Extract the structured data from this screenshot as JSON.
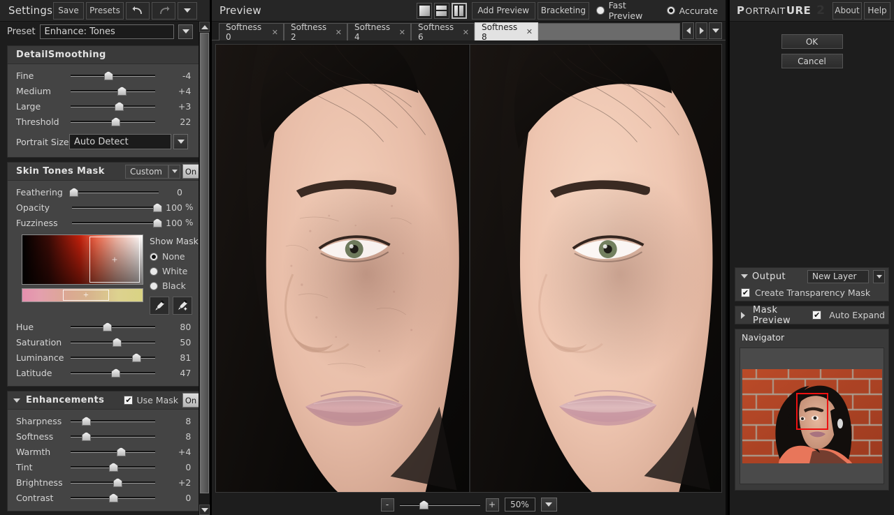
{
  "settings": {
    "title": "Settings",
    "buttons": {
      "save": "Save",
      "presets": "Presets",
      "undo": "undo-icon",
      "redo": "redo-icon",
      "menu": "chevron-down-icon"
    },
    "preset": {
      "label": "Preset",
      "value": "Enhance: Tones"
    },
    "detail_smoothing": {
      "title": "DetailSmoothing",
      "sliders": [
        {
          "label": "Fine",
          "value": "-4",
          "pos": 44
        },
        {
          "label": "Medium",
          "value": "+4",
          "pos": 60
        },
        {
          "label": "Large",
          "value": "+3",
          "pos": 57
        },
        {
          "label": "Threshold",
          "value": "22",
          "pos": 53
        }
      ],
      "portrait_size": {
        "label": "Portrait Size",
        "value": "Auto Detect"
      }
    },
    "skin_tones_mask": {
      "title": "Skin Tones Mask",
      "mode": "Custom",
      "toggle": "On",
      "sliders": [
        {
          "label": "Feathering",
          "value": "0",
          "unit": "",
          "pos": 2
        },
        {
          "label": "Opacity",
          "value": "100",
          "unit": "%",
          "pos": 98
        },
        {
          "label": "Fuzziness",
          "value": "100",
          "unit": "%",
          "pos": 98
        }
      ],
      "show_mask": {
        "label": "Show Mask:",
        "options": [
          "None",
          "White",
          "Black"
        ],
        "selected": "None"
      },
      "tools": {
        "eyedropper": "eyedropper-icon",
        "eyedropper_add": "eyedropper-add-icon"
      },
      "tone_sliders": [
        {
          "label": "Hue",
          "value": "80",
          "pos": 43
        },
        {
          "label": "Saturation",
          "value": "50",
          "pos": 54
        },
        {
          "label": "Luminance",
          "value": "81",
          "pos": 77
        },
        {
          "label": "Latitude",
          "value": "47",
          "pos": 53
        }
      ]
    },
    "enhancements": {
      "title": "Enhancements",
      "use_mask_label": "Use Mask",
      "use_mask_checked": true,
      "toggle": "On",
      "sliders": [
        {
          "label": "Sharpness",
          "value": "8",
          "pos": 18
        },
        {
          "label": "Softness",
          "value": "8",
          "pos": 18
        },
        {
          "label": "Warmth",
          "value": "+4",
          "pos": 59
        },
        {
          "label": "Tint",
          "value": "0",
          "pos": 50
        },
        {
          "label": "Brightness",
          "value": "+2",
          "pos": 55
        },
        {
          "label": "Contrast",
          "value": "0",
          "pos": 50
        }
      ]
    }
  },
  "preview": {
    "title": "Preview",
    "view_modes": [
      {
        "name": "single-view",
        "selected": false
      },
      {
        "name": "horizontal-split-view",
        "selected": false
      },
      {
        "name": "vertical-split-view",
        "selected": true
      }
    ],
    "add_preview": "Add Preview",
    "bracketing": "Bracketing",
    "quality": {
      "options": [
        "Fast Preview",
        "Accurate"
      ],
      "selected": "Accurate"
    },
    "tabs": [
      {
        "label": "Softness 0",
        "active": false
      },
      {
        "label": "Softness 2",
        "active": false
      },
      {
        "label": "Softness 4",
        "active": false
      },
      {
        "label": "Softness 6",
        "active": false
      },
      {
        "label": "Softness 8",
        "active": true
      }
    ],
    "tab_nav": {
      "prev": "prev-icon",
      "next": "next-icon",
      "menu": "chevron-down-icon"
    },
    "zoom": {
      "minus": "-",
      "plus": "+",
      "value": "50%",
      "pos": 30
    }
  },
  "plugin": {
    "brand": {
      "first": "P",
      "rest": "ORTRAIT",
      "bold": "URE",
      "version": "2"
    },
    "about": "About",
    "help": "Help",
    "ok": "OK",
    "cancel": "Cancel",
    "output": {
      "title": "Output",
      "mode": "New Layer",
      "transparency_mask_label": "Create Transparency Mask",
      "transparency_mask_checked": true
    },
    "mask_preview": {
      "title": "Mask Preview",
      "auto_expand_label": "Auto Expand",
      "auto_expand_checked": true
    },
    "navigator": {
      "title": "Navigator"
    }
  }
}
